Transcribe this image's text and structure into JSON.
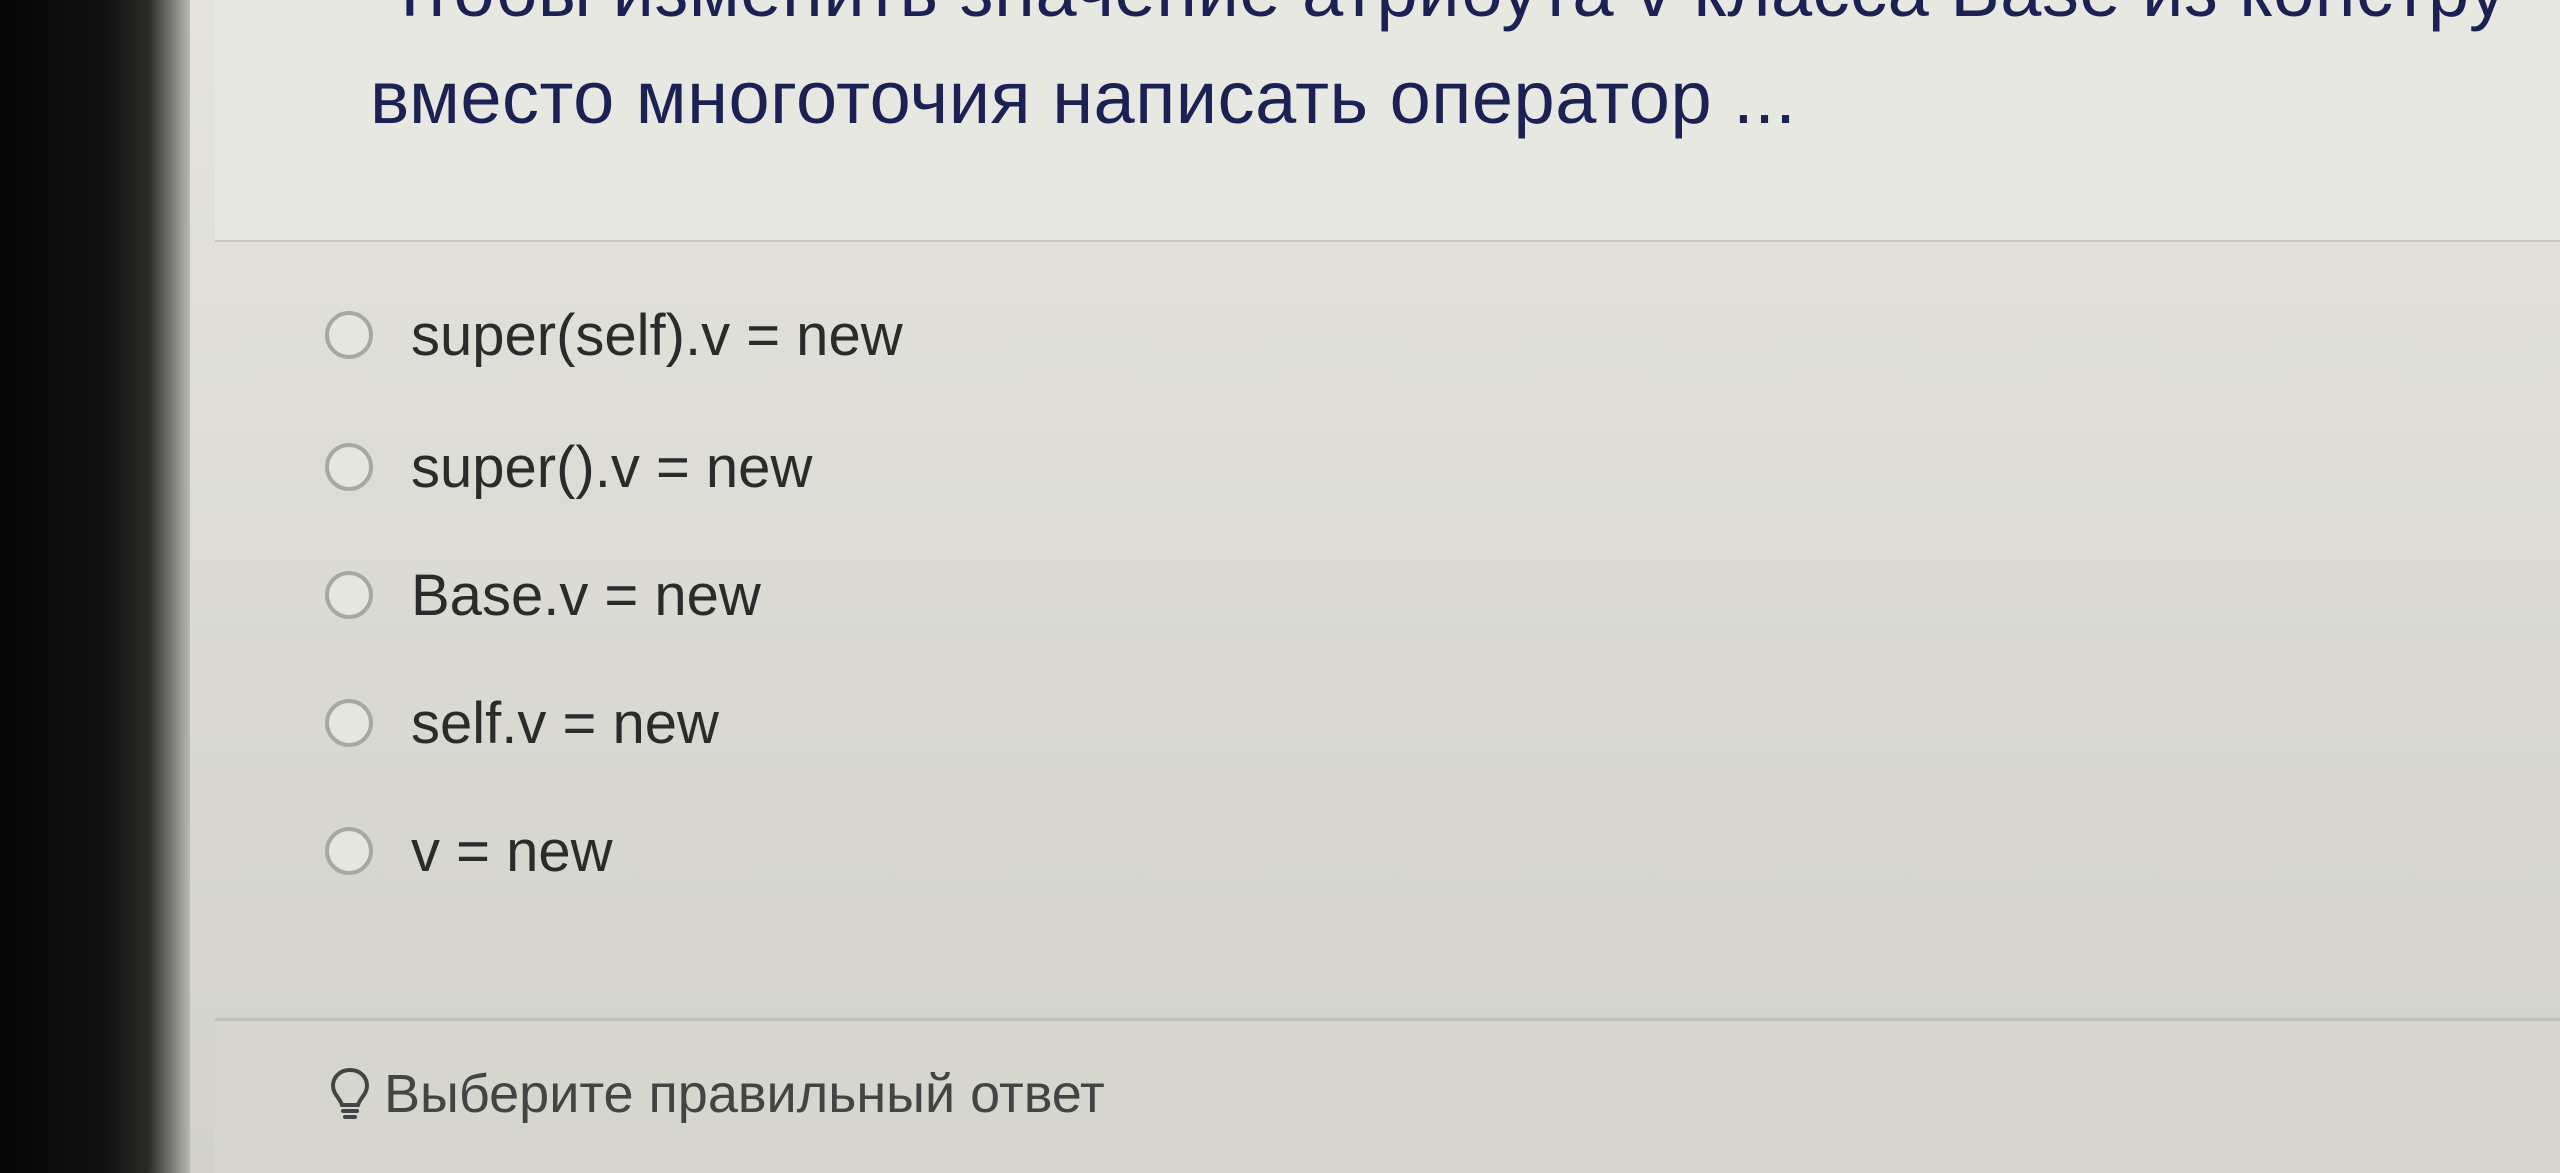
{
  "question": {
    "line1": "Чтобы изменить значение атрибута v класса Base из констру",
    "line2": "вместо многоточия написать оператор ..."
  },
  "options": [
    {
      "label": "super(self).v = new"
    },
    {
      "label": "super().v = new"
    },
    {
      "label": "Base.v = new"
    },
    {
      "label": "self.v = new"
    },
    {
      "label": "v = new"
    }
  ],
  "hint": {
    "icon": "lightbulb-icon",
    "text": "Выберите правильный ответ"
  }
}
